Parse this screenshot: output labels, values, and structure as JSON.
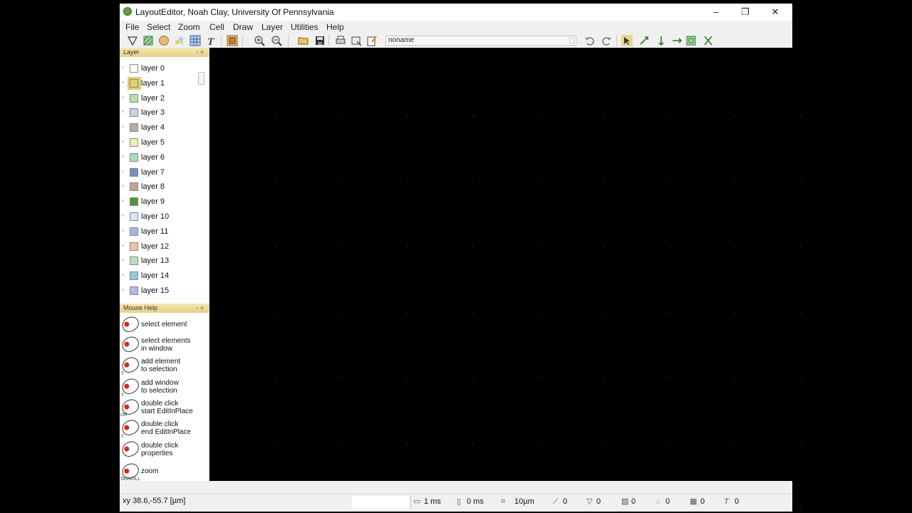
{
  "window": {
    "title": "LayoutEditor, Noah Clay, University Of Pennsylvania",
    "minimize": "–",
    "restore": "❐",
    "close": "✕"
  },
  "menu": [
    "File",
    "Select",
    "Zoom",
    "Cell",
    "Draw",
    "Layer",
    "Utilities",
    "Help"
  ],
  "toolbar": {
    "cell_name": "noname",
    "icons": [
      "polygon-draw-icon",
      "box-draw-icon",
      "circle-draw-icon",
      "path-draw-icon",
      "cellref-icon",
      "text-icon",
      "cell-icon",
      "zoom-in-icon",
      "zoom-out-icon",
      "open-icon",
      "save-icon",
      "print-icon",
      "screenshot-icon",
      "edit-icon",
      "undo-icon",
      "redo-icon",
      "select-mode-icon",
      "move-icon",
      "rotate-icon",
      "flip-icon",
      "scale-icon",
      "cut-icon"
    ]
  },
  "layer_panel": {
    "title": "Layer",
    "layers": [
      {
        "label": "layer 0",
        "color": "#ffffff",
        "selected": false
      },
      {
        "label": "layer 1",
        "color": "#e0d070",
        "selected": true
      },
      {
        "label": "layer 2",
        "color": "#b8e0b0",
        "selected": false
      },
      {
        "label": "layer 3",
        "color": "#c8d4e4",
        "selected": false
      },
      {
        "label": "layer 4",
        "color": "#b8a8b0",
        "selected": false
      },
      {
        "label": "layer 5",
        "color": "#eef0b8",
        "selected": false
      },
      {
        "label": "layer 6",
        "color": "#a8dcc0",
        "selected": false
      },
      {
        "label": "layer 7",
        "color": "#7c8eb4",
        "selected": false
      },
      {
        "label": "layer 8",
        "color": "#c8a28a",
        "selected": false
      },
      {
        "label": "layer 9",
        "color": "#4a9a30",
        "selected": false
      },
      {
        "label": "layer 10",
        "color": "#d8e8f4",
        "selected": false
      },
      {
        "label": "layer 11",
        "color": "#a8b8dc",
        "selected": false
      },
      {
        "label": "layer 12",
        "color": "#f0c0a0",
        "selected": false
      },
      {
        "label": "layer 13",
        "color": "#b8e0b8",
        "selected": false
      },
      {
        "label": "layer 14",
        "color": "#90c8e0",
        "selected": false
      },
      {
        "label": "layer 15",
        "color": "#b0b8ec",
        "selected": false
      }
    ]
  },
  "mouse_help": {
    "title": "Mouse Help",
    "items": [
      {
        "line1": "select element",
        "line2": "",
        "mod": ""
      },
      {
        "line1": "select elements",
        "line2": "in window",
        "mod": ""
      },
      {
        "line1": "add element",
        "line2": "to selection",
        "mod": "⇧"
      },
      {
        "line1": "add window",
        "line2": "to selection",
        "mod": "⇧"
      },
      {
        "line1": "double click",
        "line2": "start EditInPlace",
        "mod": "ctrl"
      },
      {
        "line1": "double click",
        "line2": "end EditInPlace",
        "mod": "⇧"
      },
      {
        "line1": "double click",
        "line2": "properties",
        "mod": ""
      },
      {
        "line1": "zoom",
        "line2": "",
        "mod": "SCROLL"
      }
    ]
  },
  "status": {
    "coords": "38.6,-55.7 [µm]",
    "coord_prefix": "xy",
    "time1": "1 ms",
    "time2": "0 ms",
    "grid": "10µm",
    "count_polygons": "0",
    "count_paths": "0",
    "count_boxes": "0",
    "count_circles": "0",
    "count_cellrefs": "0",
    "count_texts": "0"
  }
}
